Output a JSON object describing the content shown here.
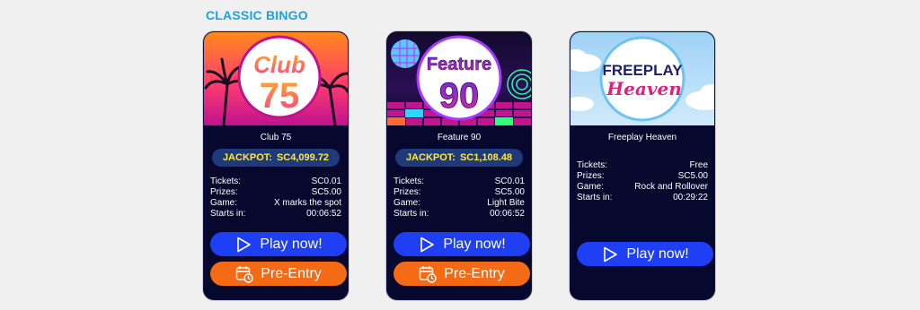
{
  "section": {
    "title": "CLASSIC BINGO"
  },
  "cards": [
    {
      "name": "Club 75",
      "logo": {
        "line1": "Club",
        "line2": "75"
      },
      "jackpot_label": "JACKPOT:",
      "jackpot_value": "SC4,099.72",
      "details": [
        {
          "label": "Tickets:",
          "value": "SC0.01"
        },
        {
          "label": "Prizes:",
          "value": "SC5.00"
        },
        {
          "label": "Game:",
          "value": "X marks the spot"
        },
        {
          "label": "Starts in:",
          "value": "00:06:52"
        }
      ],
      "play_label": "Play now!",
      "preentry_label": "Pre-Entry"
    },
    {
      "name": "Feature 90",
      "logo": {
        "line1": "Feature",
        "line2": "90"
      },
      "jackpot_label": "JACKPOT:",
      "jackpot_value": "SC1,108.48",
      "details": [
        {
          "label": "Tickets:",
          "value": "SC0.01"
        },
        {
          "label": "Prizes:",
          "value": "SC5.00"
        },
        {
          "label": "Game:",
          "value": "Light Bite"
        },
        {
          "label": "Starts in:",
          "value": "00:06:52"
        }
      ],
      "play_label": "Play now!",
      "preentry_label": "Pre-Entry"
    },
    {
      "name": "Freeplay Heaven",
      "logo": {
        "line1": "FREEPLAY",
        "line2": "Heaven"
      },
      "details": [
        {
          "label": "Tickets:",
          "value": "Free"
        },
        {
          "label": "Prizes:",
          "value": "SC5.00"
        },
        {
          "label": "Game:",
          "value": "Rock and Rollover"
        },
        {
          "label": "Starts in:",
          "value": "00:29:22"
        }
      ],
      "play_label": "Play now!"
    }
  ],
  "colors": {
    "section_title": "#1aa3e0",
    "card_bg": "#06082e",
    "jackpot_text": "#ffe83a",
    "play_button": "#1f3ff5",
    "preentry_button": "#f56a14"
  },
  "icons": {
    "play": "play-outline-icon",
    "preentry": "calendar-clock-icon"
  }
}
